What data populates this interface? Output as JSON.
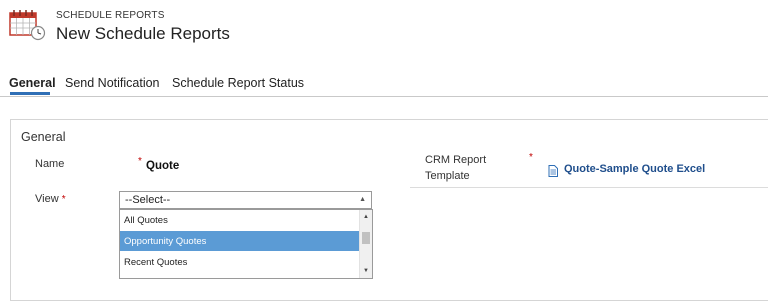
{
  "header": {
    "entity_type": "SCHEDULE REPORTS",
    "title": "New Schedule Reports",
    "icon": "calendar-report-icon"
  },
  "tabs": [
    {
      "label": "General",
      "active": true
    },
    {
      "label": "Send Notification",
      "active": false
    },
    {
      "label": "Schedule Report Status",
      "active": false
    }
  ],
  "section": {
    "title": "General",
    "name": {
      "label": "Name",
      "required": true,
      "value": "Quote"
    },
    "view": {
      "label": "View",
      "required_marker": "*",
      "selected": "--Select--",
      "options": [
        "All Quotes",
        "Opportunity Quotes",
        "Recent Quotes"
      ],
      "highlighted_option": "Opportunity Quotes"
    },
    "template": {
      "label_line1": "CRM Report",
      "label_line2": "Template",
      "required": true,
      "value": "Quote-Sample Quote Excel",
      "icon": "document-icon"
    }
  },
  "colors": {
    "accent": "#2f6fb6",
    "link": "#1f4e8c",
    "highlight": "#5b9bd5",
    "required": "#c00000"
  }
}
